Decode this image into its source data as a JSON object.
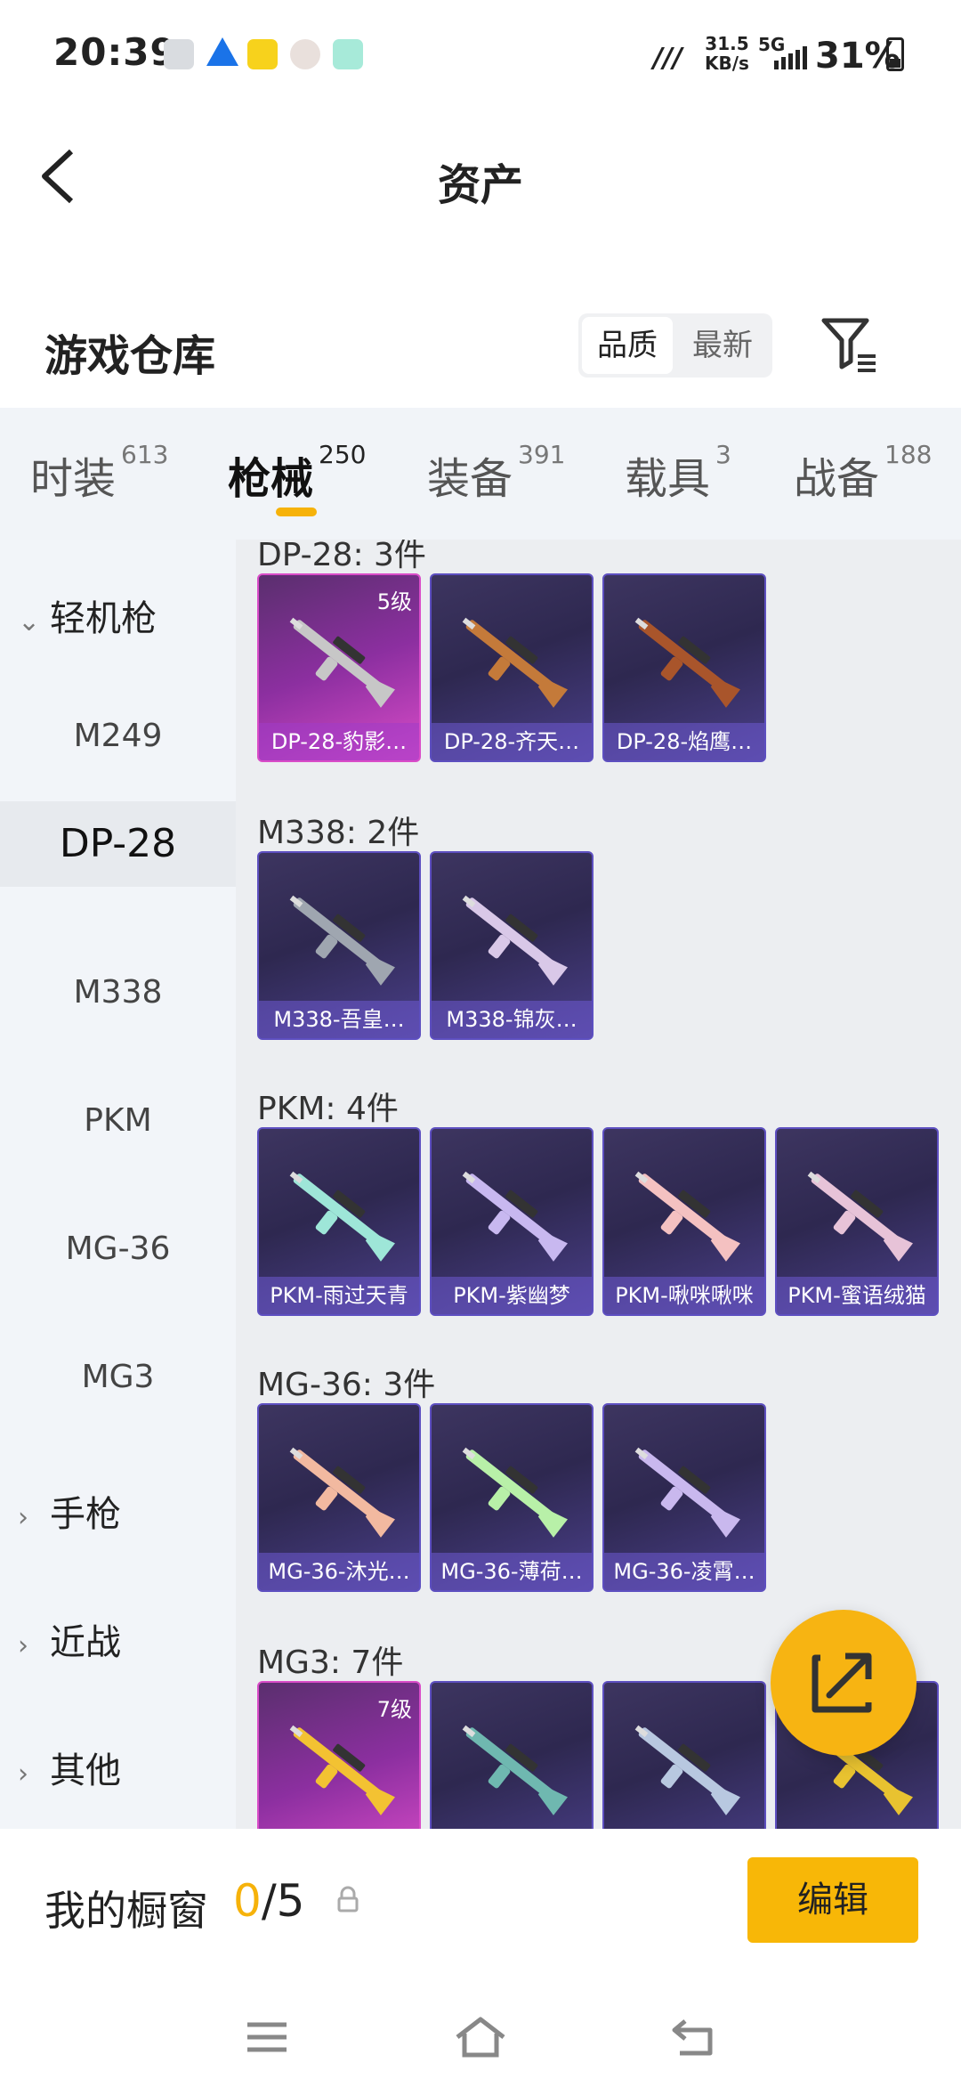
{
  "status_bar": {
    "time": "20:39",
    "speed_top": "31.5",
    "speed_bottom": "KB/s",
    "network": "5G",
    "battery": "31%"
  },
  "header": {
    "title": "资产"
  },
  "warehouse": {
    "title": "游戏仓库",
    "sort": {
      "quality": "品质",
      "newest": "最新"
    }
  },
  "tabs": [
    {
      "label": "时装",
      "count": "613"
    },
    {
      "label": "枪械",
      "count": "250"
    },
    {
      "label": "装备",
      "count": "391"
    },
    {
      "label": "载具",
      "count": "3"
    },
    {
      "label": "战备",
      "count": "188"
    }
  ],
  "sidebar": {
    "category_open": "轻机枪",
    "items": [
      "M249",
      "DP-28",
      "M338",
      "PKM",
      "MG-36",
      "MG3"
    ],
    "selected": "DP-28",
    "categories": [
      "手枪",
      "近战",
      "其他"
    ]
  },
  "groups": [
    {
      "title": "DP-28: 3件",
      "cards": [
        {
          "name": "DP-28-豹影…",
          "level": "5级",
          "rare": true
        },
        {
          "name": "DP-28-齐天…",
          "level": "",
          "rare": false
        },
        {
          "name": "DP-28-焰鹰…",
          "level": "",
          "rare": false
        }
      ]
    },
    {
      "title": "M338: 2件",
      "cards": [
        {
          "name": "M338-吾皇…",
          "level": "",
          "rare": false
        },
        {
          "name": "M338-锦灰…",
          "level": "",
          "rare": false
        }
      ]
    },
    {
      "title": "PKM: 4件",
      "cards": [
        {
          "name": "PKM-雨过天青",
          "level": "",
          "rare": false
        },
        {
          "name": "PKM-紫幽梦",
          "level": "",
          "rare": false
        },
        {
          "name": "PKM-啾咪啾咪",
          "level": "",
          "rare": false
        },
        {
          "name": "PKM-蜜语绒猫",
          "level": "",
          "rare": false
        }
      ]
    },
    {
      "title": "MG-36: 3件",
      "cards": [
        {
          "name": "MG-36-沐光…",
          "level": "",
          "rare": false
        },
        {
          "name": "MG-36-薄荷…",
          "level": "",
          "rare": false
        },
        {
          "name": "MG-36-凌霄…",
          "level": "",
          "rare": false
        }
      ]
    },
    {
      "title": "MG3: 7件",
      "cards": [
        {
          "name": "",
          "level": "7级",
          "rare": true
        },
        {
          "name": "",
          "level": "",
          "rare": false
        },
        {
          "name": "",
          "level": "",
          "rare": false
        },
        {
          "name": "",
          "level": "",
          "rare": false
        }
      ]
    }
  ],
  "showcase": {
    "label": "我的橱窗",
    "current": "0",
    "total": "/5",
    "edit": "编辑"
  },
  "colors": {
    "accent": "#f6b20a",
    "card_border": "#5d4fc0",
    "rare": "#d94cc8"
  },
  "icons": [
    "back-arrow-icon",
    "filter-icon",
    "share-export-icon",
    "lock-icon",
    "menu-icon",
    "home-icon",
    "return-icon"
  ]
}
